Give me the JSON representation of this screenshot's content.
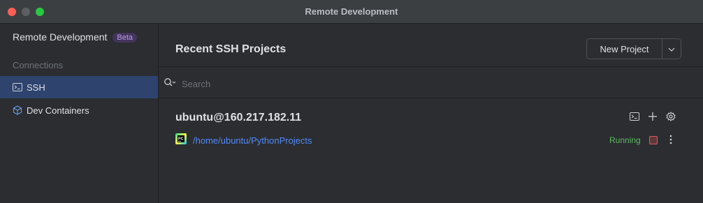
{
  "window": {
    "title": "Remote Development"
  },
  "sidebar": {
    "header": "Remote Development",
    "badge": "Beta",
    "section": "Connections",
    "items": [
      {
        "label": "SSH",
        "icon": "terminal-icon",
        "selected": true
      },
      {
        "label": "Dev Containers",
        "icon": "cube-icon",
        "selected": false
      }
    ]
  },
  "main": {
    "title": "Recent SSH Projects",
    "new_project_label": "New Project",
    "search_placeholder": "Search",
    "host": {
      "name": "ubuntu@160.217.182.11",
      "projects": [
        {
          "path": "/home/ubuntu/PythonProjects",
          "status": "Running",
          "icon": "pycharm-icon"
        }
      ]
    }
  },
  "colors": {
    "accent": "#548af7",
    "running": "#5fb865",
    "selected_bg": "#2e436e",
    "beta_badge": "#43345c"
  }
}
